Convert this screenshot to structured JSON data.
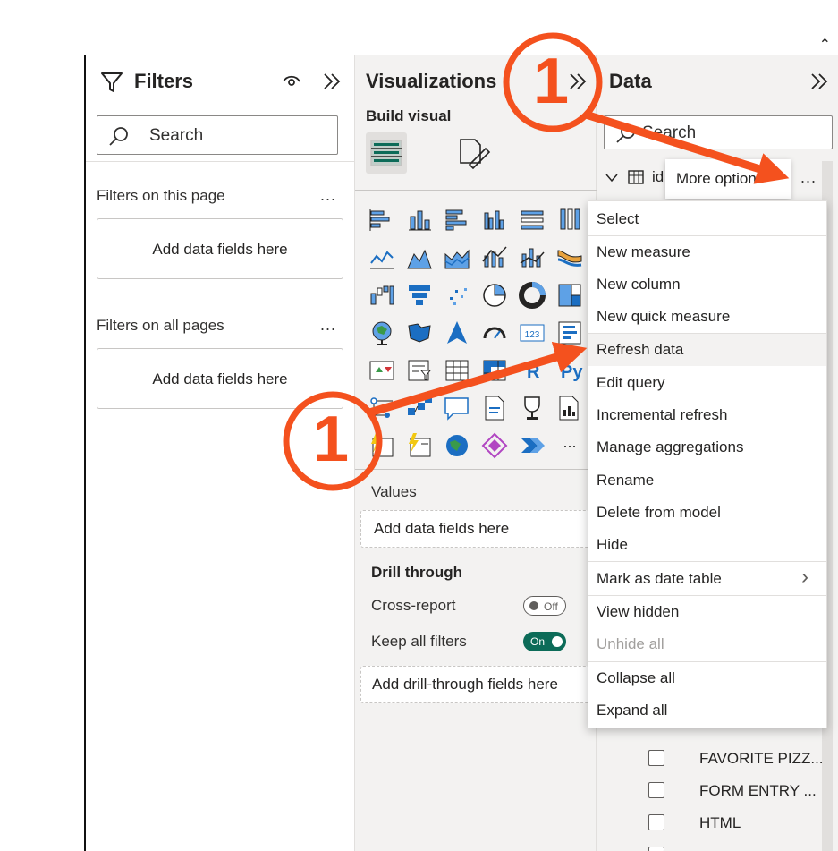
{
  "topbar": {
    "collapse_glyph": "⌃"
  },
  "filters": {
    "title": "Filters",
    "search_placeholder": "Search",
    "this_page_label": "Filters on this page",
    "this_page_well": "Add data fields here",
    "all_pages_label": "Filters on all pages",
    "all_pages_well": "Add data fields here",
    "more": "..."
  },
  "visualizations": {
    "title": "Visualizations",
    "build_visual": "Build visual",
    "more_visuals": "...",
    "values_label": "Values",
    "values_well": "Add data fields here",
    "drill_through": "Drill through",
    "cross_report": "Cross-report",
    "cross_report_toggle": "Off",
    "keep_all_filters": "Keep all filters",
    "keep_all_filters_toggle": "On",
    "drill_well": "Add drill-through fields here"
  },
  "data_pane": {
    "title": "Data",
    "search_placeholder": "Search",
    "table_name": "id",
    "more": "...",
    "fields": [
      "FAVORITE PIZZ...",
      "FORM ENTRY ...",
      "HTML"
    ]
  },
  "tooltip": "More options",
  "context_menu": {
    "items": [
      {
        "label": "Select"
      },
      {
        "label": "New measure"
      },
      {
        "label": "New column"
      },
      {
        "label": "New quick measure"
      },
      {
        "label": "Refresh data"
      },
      {
        "label": "Edit query"
      },
      {
        "label": "Incremental refresh"
      },
      {
        "label": "Manage aggregations"
      },
      {
        "label": "Rename"
      },
      {
        "label": "Delete from model"
      },
      {
        "label": "Hide"
      },
      {
        "label": "Mark as date table"
      },
      {
        "label": "View hidden"
      },
      {
        "label": "Unhide all"
      },
      {
        "label": "Collapse all"
      },
      {
        "label": "Expand all"
      }
    ],
    "submenu_glyph": "›"
  },
  "annotations": {
    "step_number": "1",
    "step_number_2": "1"
  },
  "colors": {
    "annotation": "#f4511e",
    "accent": "#0c6b58"
  }
}
